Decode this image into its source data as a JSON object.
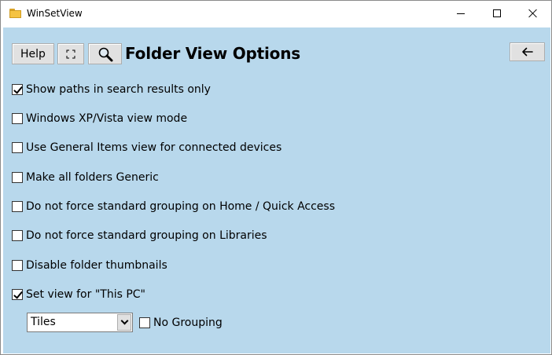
{
  "window": {
    "title": "WinSetView",
    "app_icon": "folder-icon",
    "controls": [
      "minimize-icon",
      "maximize-icon",
      "close-icon"
    ]
  },
  "toolbar": {
    "help_label": "Help",
    "fullscreen_icon": "fullscreen-icon",
    "search_icon": "magnifier-icon",
    "back_icon": "arrow-left-icon"
  },
  "heading": "Folder View Options",
  "options": [
    {
      "label": "Show paths in search results only",
      "checked": true
    },
    {
      "label": "Windows XP/Vista view mode",
      "checked": false
    },
    {
      "label": "Use General Items view for connected devices",
      "checked": false
    },
    {
      "label": "Make all folders Generic",
      "checked": false
    },
    {
      "label": "Do not force standard grouping on Home / Quick Access",
      "checked": false
    },
    {
      "label": "Do not force standard grouping on Libraries",
      "checked": false
    },
    {
      "label": "Disable folder thumbnails",
      "checked": false
    },
    {
      "label": "Set view for \"This PC\"",
      "checked": true
    }
  ],
  "this_pc": {
    "view_selected": "Tiles",
    "no_grouping_label": "No Grouping",
    "no_grouping_checked": false
  },
  "colors": {
    "client_background": "#b8d8ec",
    "button_face": "#e1e1e1",
    "folder_icon": "#f5c342"
  }
}
